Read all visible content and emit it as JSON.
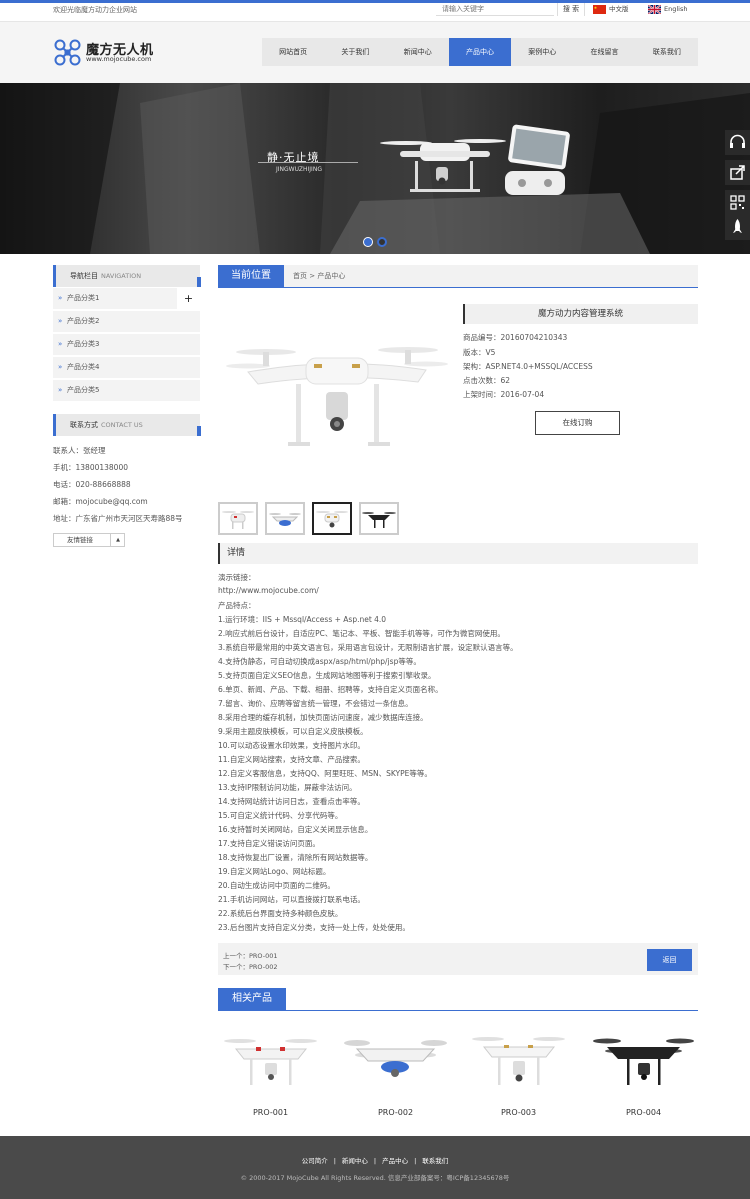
{
  "topbar": {
    "welcome": "欢迎光临魔方动力企业网站",
    "search_placeholder": "请输入关键字",
    "search_button": "搜 索",
    "lang_cn": "中文版",
    "lang_en": "English"
  },
  "header": {
    "logo_title": "魔方无人机",
    "logo_url": "www.mojocube.com"
  },
  "nav": [
    "网站首页",
    "关于我们",
    "新闻中心",
    "产品中心",
    "案例中心",
    "在线留言",
    "联系我们"
  ],
  "nav_active_index": 3,
  "banner": {
    "title": "静·无止境",
    "subtitle": "JINGWUZHIJING",
    "slides_count": 2,
    "active_slide": 0
  },
  "sidebar": {
    "nav_title": "导航栏目",
    "nav_title_en": "NAVIGATION",
    "items": [
      "产品分类1",
      "产品分类2",
      "产品分类3",
      "产品分类4",
      "产品分类5"
    ],
    "expand_symbol": "+",
    "contact_title": "联系方式",
    "contact_title_en": "CONTACT US",
    "contact": [
      "联系人：张经理",
      "手机：13800138000",
      "电话：020-88668888",
      "邮箱：mojocube@qq.com",
      "地址：广东省广州市天河区天寿路88号"
    ],
    "friend_links": "友情链接",
    "friend_arrow": "▲"
  },
  "breadcrumb": {
    "tab": "当前位置",
    "path": "首页 > 产品中心"
  },
  "product": {
    "name": "魔方动力内容管理系统",
    "specs": [
      "商品编号：20160704210343",
      "版本：V5",
      "架构：ASP.NET4.0+MSSQL/ACCESS",
      "点击次数：62",
      "上架时间：2016-07-04"
    ],
    "order_button": "在线订购",
    "active_thumb": 2
  },
  "detail": {
    "heading": "详情",
    "lines": [
      "演示链接：",
      "http://www.mojocube.com/",
      "产品特点：",
      "1.运行环境：IIS + Mssql/Access + Asp.net 4.0",
      "2.响应式前后台设计，自适应PC、笔记本、平板、智能手机等等，可作为微官网使用。",
      "3.系统自带最常用的中英文语言包，采用语言包设计，无限制语言扩展，设定默认语言等。",
      "4.支持伪静态，可自动切换成aspx/asp/html/php/jsp等等。",
      "5.支持页面自定义SEO信息，生成网站地图等利于搜索引擎收录。",
      "6.单页、新闻、产品、下载、相册、招聘等，支持自定义页面名称。",
      "7.留言、询价、应聘等留言统一管理，不会错过一条信息。",
      "8.采用合理的缓存机制，加快页面访问速度，减少数据库连接。",
      "9.采用主题皮肤模板，可以自定义皮肤模板。",
      "10.可以动态设置水印效果，支持图片水印。",
      "11.自定义网站搜索，支持文章、产品搜索。",
      "12.自定义客服信息，支持QQ、阿里旺旺、MSN、SKYPE等等。",
      "13.支持IP限制访问功能，屏蔽非法访问。",
      "14.支持网站统计访问日志，查看点击率等。",
      "15.可自定义统计代码、分享代码等。",
      "16.支持暂时关闭网站，自定义关闭显示信息。",
      "17.支持自定义错误访问页面。",
      "18.支持恢复出厂设置，清除所有网站数据等。",
      "19.自定义网站Logo、网站标题。",
      "20.自动生成访问中页面的二维码。",
      "21.手机访问网站，可以直接拨打联系电话。",
      "22.系统后台界面支持多种颜色皮肤。",
      "23.后台图片支持自定义分类，支持一处上传，处处使用。"
    ]
  },
  "pager": {
    "prev": "上一个：PRO-001",
    "next": "下一个：PRO-002",
    "back": "返回"
  },
  "related": {
    "heading": "相关产品",
    "items": [
      "PRO-001",
      "PRO-002",
      "PRO-003",
      "PRO-004"
    ]
  },
  "footer": {
    "links": [
      "公司简介",
      "新闻中心",
      "产品中心",
      "联系我们"
    ],
    "separator": "|",
    "copyright": "© 2000-2017 MojoCube All Rights Reserved. 信息产业部备案号：粤ICP备12345678号"
  },
  "colors": {
    "accent": "#3b6ed0",
    "footer_bg": "#4a4a4a",
    "nav_bg": "#e8e8e8"
  }
}
